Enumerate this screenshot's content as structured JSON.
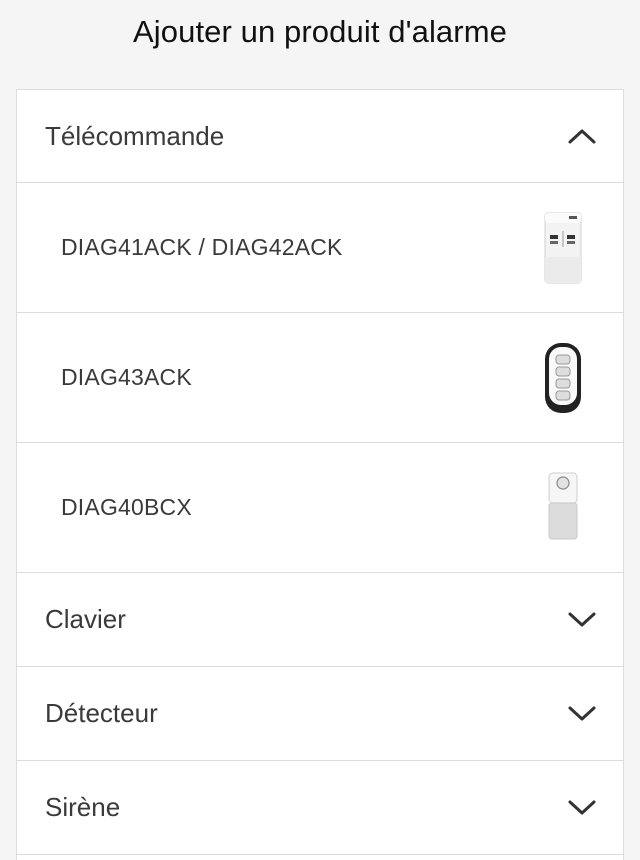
{
  "page": {
    "title": "Ajouter un produit d'alarme"
  },
  "categories": [
    {
      "label": "Télécommande",
      "expanded": true,
      "chevron": "chevron-up-icon",
      "products": [
        {
          "label": "DIAG41ACK / DIAG42ACK",
          "image": "keypad-control-unit-image"
        },
        {
          "label": "DIAG43ACK",
          "image": "keyfob-remote-image"
        },
        {
          "label": "DIAG40BCX",
          "image": "single-button-remote-image"
        }
      ]
    },
    {
      "label": "Clavier",
      "expanded": false,
      "chevron": "chevron-down-icon"
    },
    {
      "label": "Détecteur",
      "expanded": false,
      "chevron": "chevron-down-icon"
    },
    {
      "label": "Sirène",
      "expanded": false,
      "chevron": "chevron-down-icon"
    }
  ],
  "colors": {
    "background": "#f5f5f5",
    "card": "#ffffff",
    "divider": "#dcdcdc",
    "title_text": "#111111",
    "item_text": "#3a3a3a"
  }
}
